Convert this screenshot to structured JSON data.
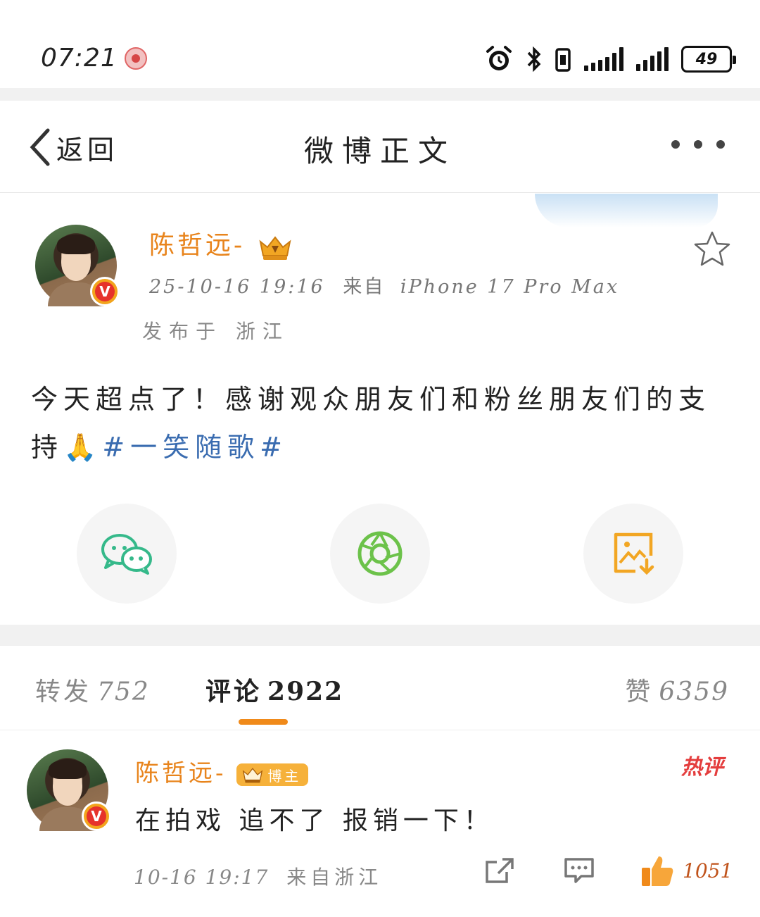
{
  "status_bar": {
    "time": "07:21",
    "battery": "49",
    "icons": [
      "alarm-icon",
      "bluetooth-icon",
      "vibrate-icon",
      "signal-icon",
      "battery-icon"
    ]
  },
  "nav": {
    "back_label": "返回",
    "title": "微博正文",
    "more_icon": "more-dots-icon"
  },
  "post": {
    "author": "陈哲远-",
    "timestamp": "25-10-16 19:16",
    "source_prefix": "来自",
    "source_device": "iPhone 17 Pro Max",
    "location": "发布于 浙江",
    "text_main": "今天超点了！感谢观众朋友们和粉丝朋友们的支持",
    "emoji": "🙏",
    "hashtag": "#一笑随歌#",
    "share_buttons": [
      "wechat-icon",
      "moments-icon",
      "save-image-icon"
    ],
    "colors": {
      "author": "#e8841c",
      "hashtag": "#3a6cb0",
      "verified": "#e6322b"
    }
  },
  "tabs": {
    "repost_label": "转发",
    "repost_count": "752",
    "comment_label": "评论",
    "comment_count": "2922",
    "like_label": "赞",
    "like_count": "6359",
    "accent": "#f08a1a"
  },
  "comment": {
    "author": "陈哲远-",
    "badge": "博主",
    "hot_tag": "热评",
    "text": "在拍戏 追不了 报销一下！",
    "time": "10-16 19:17",
    "source": "来自浙江",
    "like_count": "1051"
  }
}
